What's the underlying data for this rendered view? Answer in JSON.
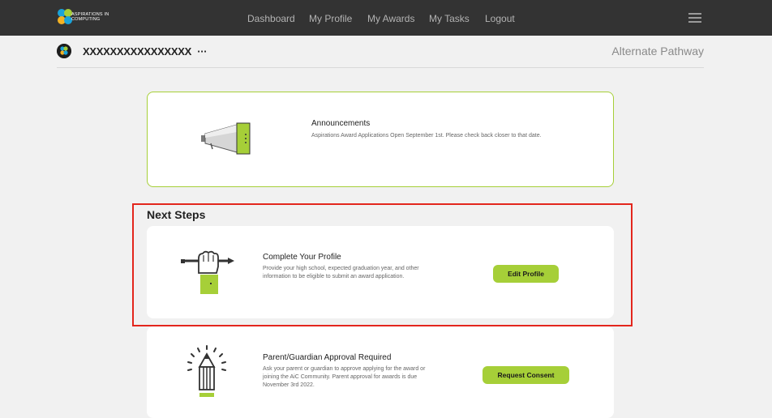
{
  "nav": {
    "logo_text_line1": "ASPIRATIONS IN",
    "logo_text_line2": "COMPUTING",
    "links": [
      "Dashboard",
      "My Profile",
      "My Awards",
      "My Tasks",
      "Logout"
    ]
  },
  "header": {
    "username": "XXXXXXXXXXXXXXXX",
    "more": "···",
    "pathway": "Alternate Pathway"
  },
  "announcement": {
    "title": "Announcements",
    "body": "Aspirations Award Applications Open September 1st. Please check back closer to that date."
  },
  "next_steps": {
    "title": "Next Steps",
    "items": [
      {
        "title": "Complete Your Profile",
        "body": "Provide your high school, expected graduation year, and other information to be eligible to submit an award application.",
        "button": "Edit Profile"
      },
      {
        "title": "Parent/Guardian Approval Required",
        "body": "Ask your parent or guardian to approve applying for the award or joining the AiC Community. Parent approval for awards is due November 3rd 2022.",
        "button": "Request Consent"
      }
    ]
  },
  "colors": {
    "accent": "#a6cf38",
    "nav_bg": "#333333",
    "highlight": "#e3261d"
  }
}
